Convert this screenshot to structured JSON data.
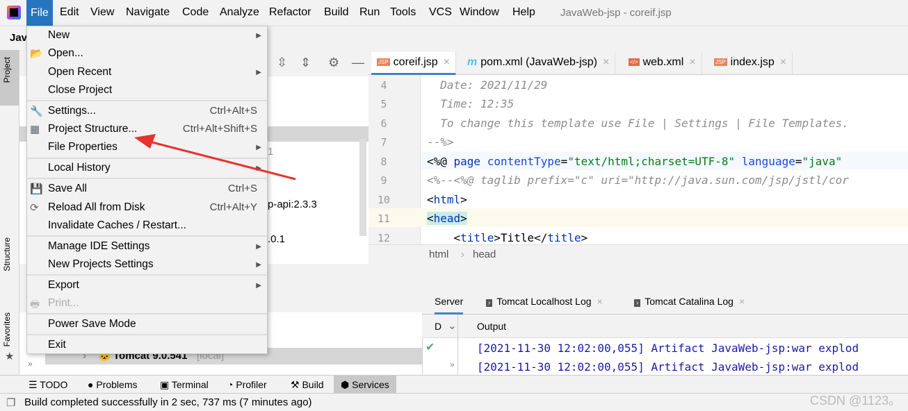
{
  "window": {
    "title": "JavaWeb-jsp - coreif.jsp",
    "project_short": "Jav"
  },
  "menubar": [
    "File",
    "Edit",
    "View",
    "Navigate",
    "Code",
    "Analyze",
    "Refactor",
    "Build",
    "Run",
    "Tools",
    "VCS",
    "Window",
    "Help"
  ],
  "file_menu": {
    "new": "New",
    "open": "Open...",
    "open_recent": "Open Recent",
    "close_project": "Close Project",
    "settings": "Settings...",
    "settings_sc": "Ctrl+Alt+S",
    "project_structure": "Project Structure...",
    "project_structure_sc": "Ctrl+Alt+Shift+S",
    "file_properties": "File Properties",
    "local_history": "Local History",
    "save_all": "Save All",
    "save_all_sc": "Ctrl+S",
    "reload": "Reload All from Disk",
    "reload_sc": "Ctrl+Alt+Y",
    "invalidate": "Invalidate Caches / Restart...",
    "manage_ide": "Manage IDE Settings",
    "new_projects": "New Projects Settings",
    "export": "Export",
    "print": "Print...",
    "power_save": "Power Save Mode",
    "exit": "Exit"
  },
  "side_tabs": {
    "project": "Project",
    "structure": "Structure",
    "favorites": "Favorites"
  },
  "project_tree_fragments": {
    "frag1": "1",
    "frag2": "p-api:2.3.3",
    "frag3": ".0.1"
  },
  "editor": {
    "tabs": [
      {
        "label": "coreif.jsp",
        "icon": "jsp-icon"
      },
      {
        "label": "pom.xml (JavaWeb-jsp)",
        "icon": "maven-icon"
      },
      {
        "label": "web.xml",
        "icon": "xml-icon"
      },
      {
        "label": "index.jsp",
        "icon": "jsp-icon"
      }
    ],
    "line_numbers": [
      "4",
      "5",
      "6",
      "7",
      "8",
      "9",
      "10",
      "11",
      "12"
    ],
    "lines": {
      "l4": "  Date: 2021/11/29",
      "l5": "  Time: 12:35",
      "l6": "  To change this template use File | Settings | File Templates.",
      "l7": "--%>",
      "l8a": "<%@ ",
      "l8b": "page ",
      "l8c": "contentType",
      "l8d": "=",
      "l8e": "\"text/html;charset=UTF-8\"",
      "l8f": " language",
      "l8g": "=",
      "l8h": "\"java\"",
      "l9": "<%--<%@ taglib prefix=\"c\" uri=\"http://java.sun.com/jsp/jstl/cor",
      "l10": "html",
      "l11": "head",
      "l12a": "title",
      "l12b": "Title"
    },
    "breadcrumb": [
      "html",
      "head"
    ]
  },
  "services": {
    "tomcat": "Tomcat 9.0.541",
    "tomcat_suffix": "[local]",
    "tabs": [
      "Server",
      "Tomcat Localhost Log",
      "Tomcat Catalina Log"
    ],
    "col_d": "D",
    "output_label": "Output",
    "log": [
      "[2021-11-30 12:02:00,055] Artifact JavaWeb-jsp:war explod",
      "[2021-11-30 12:02:00,055] Artifact JavaWeb-jsp:war explod"
    ]
  },
  "toolwindows": [
    "TODO",
    "Problems",
    "Terminal",
    "Profiler",
    "Build",
    "Services"
  ],
  "status": "Build completed successfully in 2 sec, 737 ms (7 minutes ago)",
  "watermark": "CSDN @1123。",
  "colors": {
    "menu_highlight": "#2675bf",
    "arrow": "#e8322c"
  }
}
